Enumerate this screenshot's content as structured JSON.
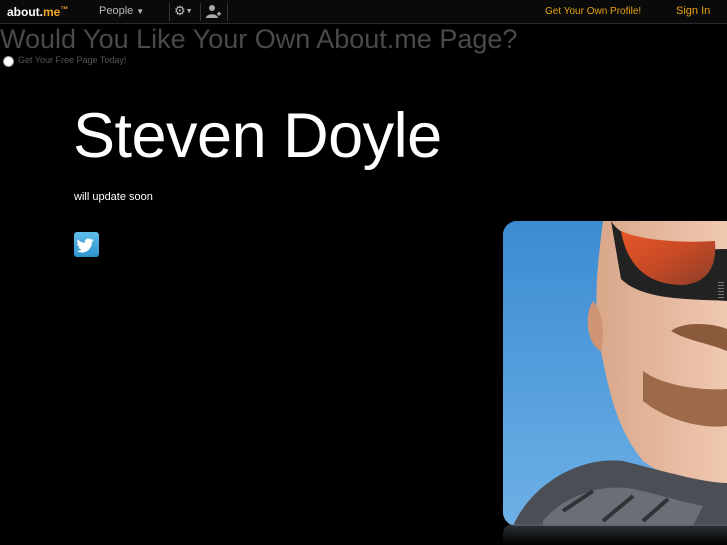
{
  "topbar": {
    "logo_main": "about.",
    "logo_me": "me",
    "logo_tm": "™",
    "people_label": "People",
    "get_own_profile": "Get Your Own Profile!",
    "sign_in": "Sign In"
  },
  "promo": {
    "title": "Would You Like Your Own About.me Page?",
    "link": "Get Your Free Page Today!"
  },
  "profile": {
    "name": "Steven Doyle",
    "status": "will update soon"
  },
  "colors": {
    "accent": "#e8a317",
    "background": "#000000",
    "twitter": "#3aa3d8"
  },
  "icons": {
    "gear": "gear-icon",
    "person": "add-person-icon",
    "twitter": "twitter-icon"
  }
}
